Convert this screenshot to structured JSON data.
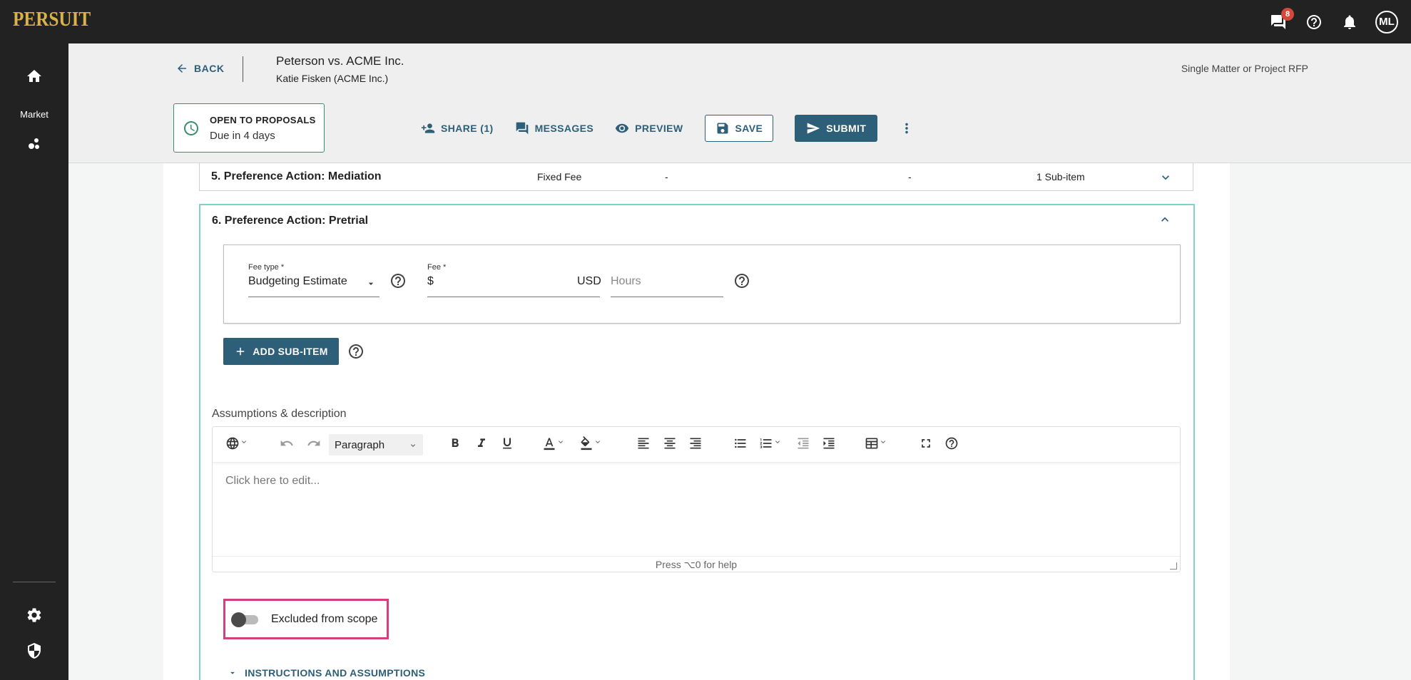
{
  "app": {
    "logo": "PERSUIT",
    "message_badge": "8",
    "avatar_initials": "ML"
  },
  "sidebar": {
    "market_label": "Market"
  },
  "header": {
    "back_label": "BACK",
    "title": "Peterson vs. ACME Inc.",
    "subtitle": "Katie Fisken (ACME Inc.)",
    "rfp_type": "Single Matter or Project RFP",
    "status_line1": "OPEN TO PROPOSALS",
    "status_line2": "Due in 4 days",
    "share_label": "SHARE (1)",
    "messages_label": "MESSAGES",
    "preview_label": "PREVIEW",
    "save_label": "SAVE",
    "submit_label": "SUBMIT"
  },
  "row5": {
    "name": "5. Preference Action: Mediation",
    "fee_type": "Fixed Fee",
    "col2": "-",
    "col3": "-",
    "subitems": "1 Sub-item"
  },
  "row6": {
    "name": "6. Preference Action: Pretrial",
    "fee_type_label": "Fee type *",
    "fee_type_value": "Budgeting Estimate",
    "fee_label": "Fee *",
    "fee_currency_symbol": "$",
    "fee_currency": "USD",
    "hours_placeholder": "Hours",
    "add_subitem_label": "ADD SUB-ITEM",
    "assumptions_label": "Assumptions & description",
    "paragraph_style": "Paragraph",
    "editor_placeholder": "Click here to edit...",
    "editor_help": "Press ⌥0 for help",
    "excluded_label": "Excluded from scope",
    "instructions_label": "INSTRUCTIONS AND ASSUMPTIONS"
  },
  "colors": {
    "primary": "#2d5f78",
    "highlight": "#d63f7e",
    "panel_border": "#7fd4c7",
    "topbar": "#222222"
  }
}
